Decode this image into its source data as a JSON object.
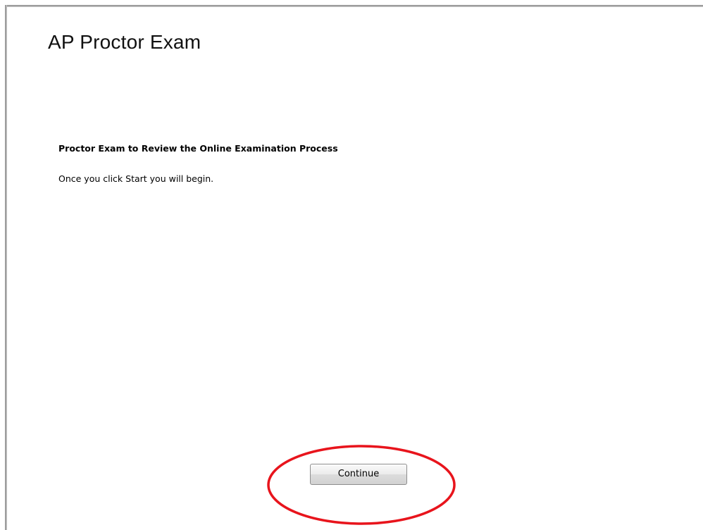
{
  "page": {
    "title": "AP Proctor Exam"
  },
  "content": {
    "heading": "Proctor Exam to Review the Online Examination Process",
    "body": "Once you click Start you will begin."
  },
  "actions": {
    "continue_label": "Continue"
  },
  "annotation": {
    "highlight_color": "#e8141c"
  }
}
